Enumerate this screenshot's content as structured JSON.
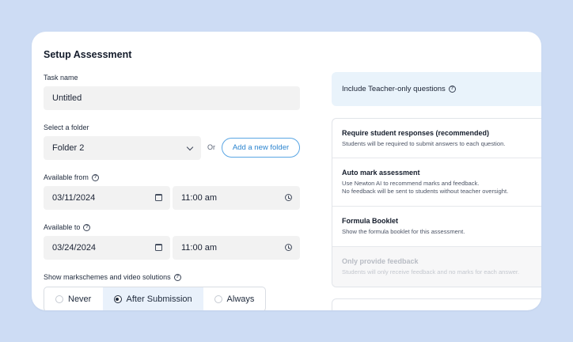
{
  "form": {
    "title": "Setup Assessment",
    "task_name": {
      "label": "Task name",
      "value": "Untitled"
    },
    "folder": {
      "label": "Select a folder",
      "value": "Folder 2",
      "or_text": "Or",
      "add_label": "Add a new folder"
    },
    "available_from": {
      "label": "Available from",
      "date": "03/11/2024",
      "time": "11:00 am"
    },
    "available_to": {
      "label": "Available to",
      "date": "03/24/2024",
      "time": "11:00 am"
    },
    "solutions": {
      "label": "Show markschemes and video solutions",
      "options": [
        "Never",
        "After Submission",
        "Always"
      ],
      "selected": "After Submission"
    }
  },
  "settings": {
    "teacher_only": {
      "label": "Include Teacher-only questions"
    },
    "options": [
      {
        "title": "Require student responses (recommended)",
        "desc": "Students will be required to submit answers to each question."
      },
      {
        "title": "Auto mark assessment",
        "desc": "Use Newton AI to recommend marks and feedback.",
        "desc2": "No feedback will be sent to students without teacher oversight."
      },
      {
        "title": "Formula Booklet",
        "desc": "Show the formula booklet for this assessment."
      },
      {
        "title": "Only provide feedback",
        "desc": "Students will only receive feedback and no marks for each answer.",
        "disabled": true
      }
    ]
  },
  "colors": {
    "background": "#cddcf4",
    "accent": "#2b84cf",
    "selected_option_bg": "#e9f1fb",
    "teacher_row_bg": "#e9f3fb"
  },
  "icons": [
    "help-icon",
    "chevron-down-icon",
    "calendar-icon",
    "clock-icon",
    "radio-icon"
  ]
}
